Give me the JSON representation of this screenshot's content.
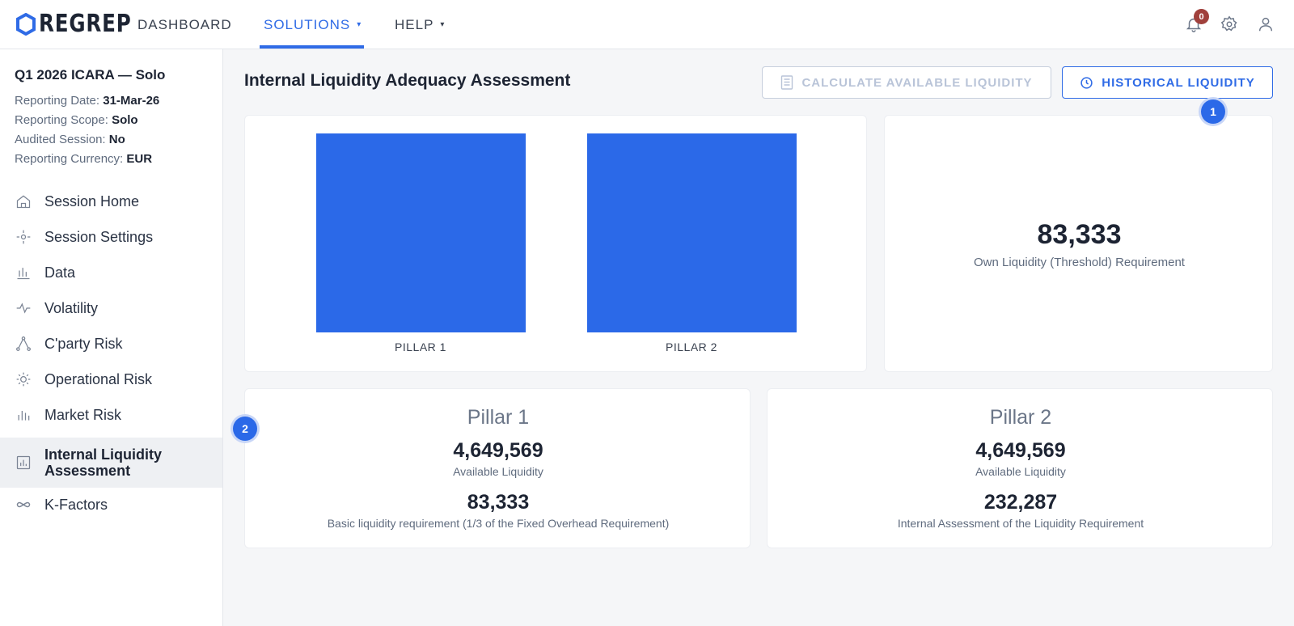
{
  "brand": {
    "name": "REGREP",
    "accent": "#2f6be6"
  },
  "nav": {
    "dashboard": "DASHBOARD",
    "solutions": "SOLUTIONS",
    "help": "HELP",
    "caret": "▾"
  },
  "header_icons": {
    "notifications_count": "0",
    "notifications": "bell-icon",
    "settings": "gear-icon",
    "account": "user-icon"
  },
  "session": {
    "title": "Q1 2026 ICARA — Solo",
    "reporting_date_label": "Reporting Date:",
    "reporting_date": "31-Mar-26",
    "scope_label": "Reporting Scope:",
    "scope": "Solo",
    "audited_label": "Audited Session:",
    "audited": "No",
    "currency_label": "Reporting Currency:",
    "currency": "EUR"
  },
  "sidebar": {
    "items": [
      {
        "label": "Session Home",
        "icon": "home-icon"
      },
      {
        "label": "Session Settings",
        "icon": "settings-icon"
      },
      {
        "label": "Data",
        "icon": "bar-chart-icon"
      },
      {
        "label": "Volatility",
        "icon": "pulse-icon"
      },
      {
        "label": "C'party Risk",
        "icon": "network-icon"
      },
      {
        "label": "Operational Risk",
        "icon": "sun-icon"
      },
      {
        "label": "Market Risk",
        "icon": "bars-icon"
      },
      {
        "label": "Internal Liquidity Assessment",
        "icon": "report-icon",
        "active": true
      },
      {
        "label": "K-Factors",
        "icon": "infinity-icon"
      }
    ]
  },
  "main": {
    "title": "Internal Liquidity Adequacy Assessment",
    "calc_button": "CALCULATE AVAILABLE LIQUIDITY",
    "history_button": "HISTORICAL LIQUIDITY",
    "markers": [
      "1",
      "2"
    ],
    "threshold": {
      "value": "83,333",
      "label": "Own Liquidity (Threshold) Requirement"
    },
    "pillar1": {
      "title": "Pillar 1",
      "available_value": "4,649,569",
      "available_label": "Available Liquidity",
      "req_value": "83,333",
      "req_label": "Basic liquidity requirement (1/3 of the Fixed Overhead Requirement)"
    },
    "pillar2": {
      "title": "Pillar 2",
      "available_value": "4,649,569",
      "available_label": "Available Liquidity",
      "req_value": "232,287",
      "req_label": "Internal Assessment of the Liquidity Requirement"
    }
  },
  "chart_data": {
    "type": "bar",
    "categories": [
      "PILLAR 1",
      "PILLAR 2"
    ],
    "values": [
      4649569,
      4649569
    ],
    "color": "#2b69e8",
    "ylim": [
      0,
      4649569
    ],
    "grid": false
  }
}
